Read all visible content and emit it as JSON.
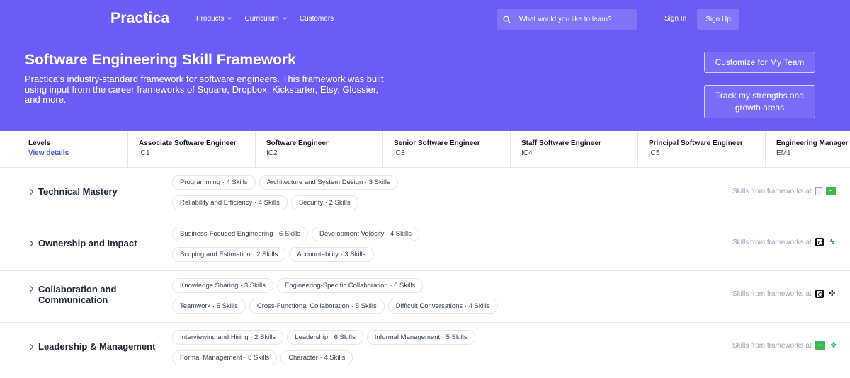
{
  "header": {
    "logo": "Practica",
    "nav": [
      {
        "label": "Products",
        "has_dropdown": true
      },
      {
        "label": "Curriculum",
        "has_dropdown": true
      },
      {
        "label": "Customers",
        "has_dropdown": false
      }
    ],
    "search_placeholder": "What would you like to learn?",
    "sign_in": "Sign In",
    "sign_up": "Sign Up"
  },
  "hero": {
    "title": "Software Engineering Skill Framework",
    "description": "Practica's industry-standard framework for software engineers. This framework was built using input from the career frameworks of Square, Dropbox, Kickstarter, Etsy, Glossier, and more.",
    "btn_customize": "Customize for My Team",
    "btn_track": "Track my strengths and growth areas"
  },
  "levels": {
    "label": "Levels",
    "view_details": "View details",
    "items": [
      {
        "name": "Associate Software Engineer",
        "code": "IC1"
      },
      {
        "name": "Software Engineer",
        "code": "IC2"
      },
      {
        "name": "Senior Software Engineer",
        "code": "IC3"
      },
      {
        "name": "Staff Software Engineer",
        "code": "IC4"
      },
      {
        "name": "Principal Software Engineer",
        "code": "IC5"
      },
      {
        "name": "Engineering Manager",
        "code": "EM1"
      }
    ]
  },
  "frameworks_label": "Skills from frameworks at",
  "categories": [
    {
      "title_lines": [
        "Technical Mastery"
      ],
      "chips": [
        "Programming · 4 Skills",
        "Architecture and System Design · 3 Skills",
        "Reliability and Efficiency · 4 Skills",
        "Security · 2 Skills"
      ],
      "logos": [
        "doc-icon",
        "green-logo-icon"
      ]
    },
    {
      "title_lines": [
        "Ownership and Impact"
      ],
      "chips": [
        "Business-Focused Engineering · 6 Skills",
        "Development Velocity · 4 Skills",
        "Scoping and Estimation · 2 Skills",
        "Accountability · 3 Skills"
      ],
      "logos": [
        "square-logo-icon",
        "blue-glyph-icon"
      ]
    },
    {
      "title_lines": [
        "Collaboration and",
        "Communication"
      ],
      "chips": [
        "Knowledge Sharing · 3 Skills",
        "Engineering-Specific Collaboration · 6 Skills",
        "Teamwork · 5 Skills",
        "Cross-Functional Collaboration · 5 Skills",
        "Difficult Conversations · 4 Skills"
      ],
      "logos": [
        "square-logo-icon",
        "dark-glyph-icon"
      ]
    },
    {
      "title_lines": [
        "Leadership & Management"
      ],
      "chips": [
        "Interviewing and Hiring · 2 Skills",
        "Leadership · 6 Skills",
        "Informal Management · 5 Skills",
        "Formal Management · 8 Skills",
        "Character · 4 Skills"
      ],
      "logos": [
        "green-logo-icon",
        "teal-glyph-icon"
      ]
    }
  ],
  "colors": {
    "hero_bg": "#6c5cf6",
    "link": "#4b57d8"
  }
}
